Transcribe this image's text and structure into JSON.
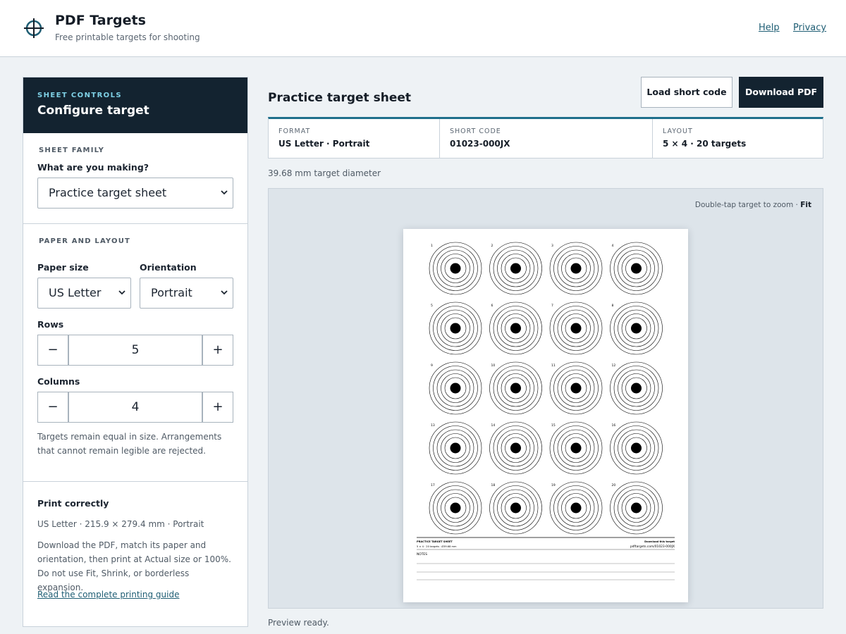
{
  "header": {
    "title": "PDF Targets",
    "subtitle": "Free printable targets for shooting",
    "nav": {
      "help": "Help",
      "privacy": "Privacy"
    }
  },
  "sidebar": {
    "eyebrow": "SHEET CONTROLS",
    "title": "Configure target",
    "family": {
      "section": "SHEET FAMILY",
      "label": "What are you making?",
      "selected": "Practice target sheet"
    },
    "layout": {
      "section": "PAPER AND LAYOUT",
      "paper_label": "Paper size",
      "paper_value": "US Letter",
      "orientation_label": "Orientation",
      "orientation_value": "Portrait",
      "rows_label": "Rows",
      "rows_value": "5",
      "columns_label": "Columns",
      "columns_value": "4",
      "decrement": "−",
      "increment": "+",
      "help": "Targets remain equal in size. Arrangements that cannot remain legible are rejected."
    },
    "print": {
      "title": "Print correctly",
      "spec": "US Letter · 215.9 × 279.4 mm · Portrait",
      "instructions": "Download the PDF, match its paper and orientation, then print at Actual size or 100%. Do not use Fit, Shrink, or borderless expansion.",
      "guide_link": "Read the complete printing guide"
    }
  },
  "main": {
    "title": "Practice target sheet",
    "load_button": "Load short code",
    "download_button": "Download PDF",
    "info": [
      {
        "label": "FORMAT",
        "value": "US Letter · Portrait"
      },
      {
        "label": "SHORT CODE",
        "value": "01023-000JX"
      },
      {
        "label": "LAYOUT",
        "value": "5 × 4 · 20 targets"
      }
    ],
    "diameter": "39.68 mm target diameter",
    "zoom_hint": "Double-tap target to zoom ·",
    "zoom_mode": "Fit",
    "status": "Preview ready."
  },
  "sheet": {
    "rows": 5,
    "columns": 4,
    "footer_title": "PRACTICE TARGET SHEET",
    "footer_meta": "5 × 4 · 20 targets · Ø39.68 mm",
    "footer_download": "Download this target",
    "footer_url": "pdftargets.com/01023-000JX",
    "notes_label": "NOTES"
  },
  "colors": {
    "accent": "#1f6f8b",
    "dark": "#132330",
    "link": "#1f5e74"
  }
}
